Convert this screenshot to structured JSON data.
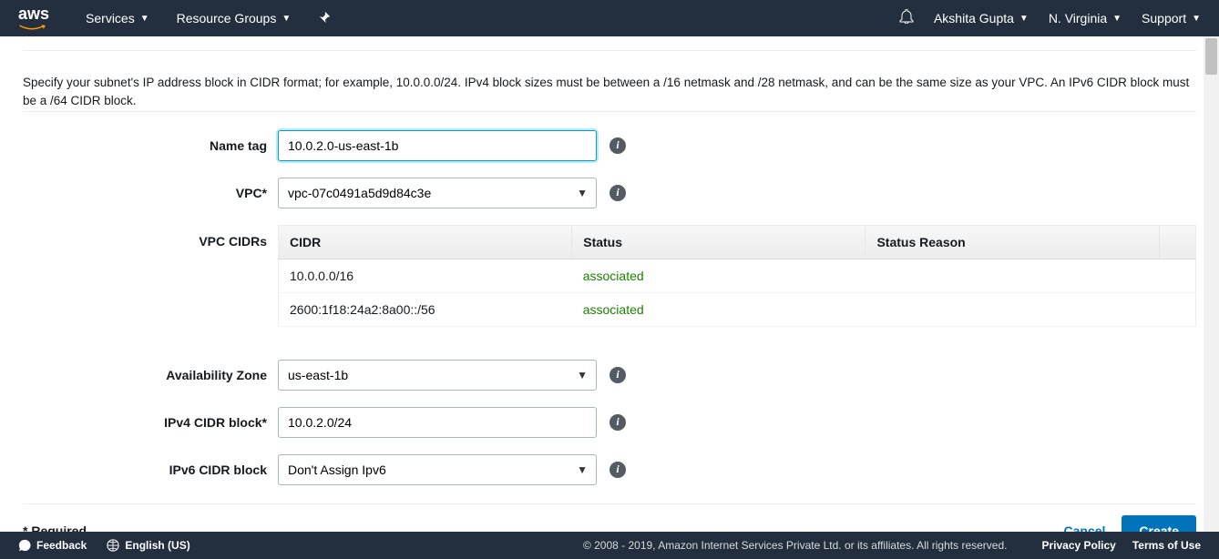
{
  "header": {
    "logo": "aws",
    "services": "Services",
    "resource_groups": "Resource Groups",
    "user": "Akshita Gupta",
    "region": "N. Virginia",
    "support": "Support"
  },
  "description": "Specify your subnet's IP address block in CIDR format; for example, 10.0.0.0/24. IPv4 block sizes must be between a /16 netmask and /28 netmask, and can be the same size as your VPC. An IPv6 CIDR block must be a /64 CIDR block.",
  "form": {
    "name_tag_label": "Name tag",
    "name_tag_value": "10.0.2.0-us-east-1b",
    "vpc_label": "VPC*",
    "vpc_value": "vpc-07c0491a5d9d84c3e",
    "vpc_cidrs_label": "VPC CIDRs",
    "az_label": "Availability Zone",
    "az_value": "us-east-1b",
    "ipv4_label": "IPv4 CIDR block*",
    "ipv4_value": "10.0.2.0/24",
    "ipv6_label": "IPv6 CIDR block",
    "ipv6_value": "Don't Assign Ipv6"
  },
  "table": {
    "headers": {
      "cidr": "CIDR",
      "status": "Status",
      "reason": "Status Reason"
    },
    "rows": [
      {
        "cidr": "10.0.0.0/16",
        "status": "associated",
        "reason": ""
      },
      {
        "cidr": "2600:1f18:24a2:8a00::/56",
        "status": "associated",
        "reason": ""
      }
    ]
  },
  "actions": {
    "required": "* Required",
    "cancel": "Cancel",
    "create": "Create"
  },
  "footer": {
    "feedback": "Feedback",
    "language": "English (US)",
    "copyright": "© 2008 - 2019, Amazon Internet Services Private Ltd. or its affiliates. All rights reserved.",
    "privacy": "Privacy Policy",
    "terms": "Terms of Use"
  }
}
